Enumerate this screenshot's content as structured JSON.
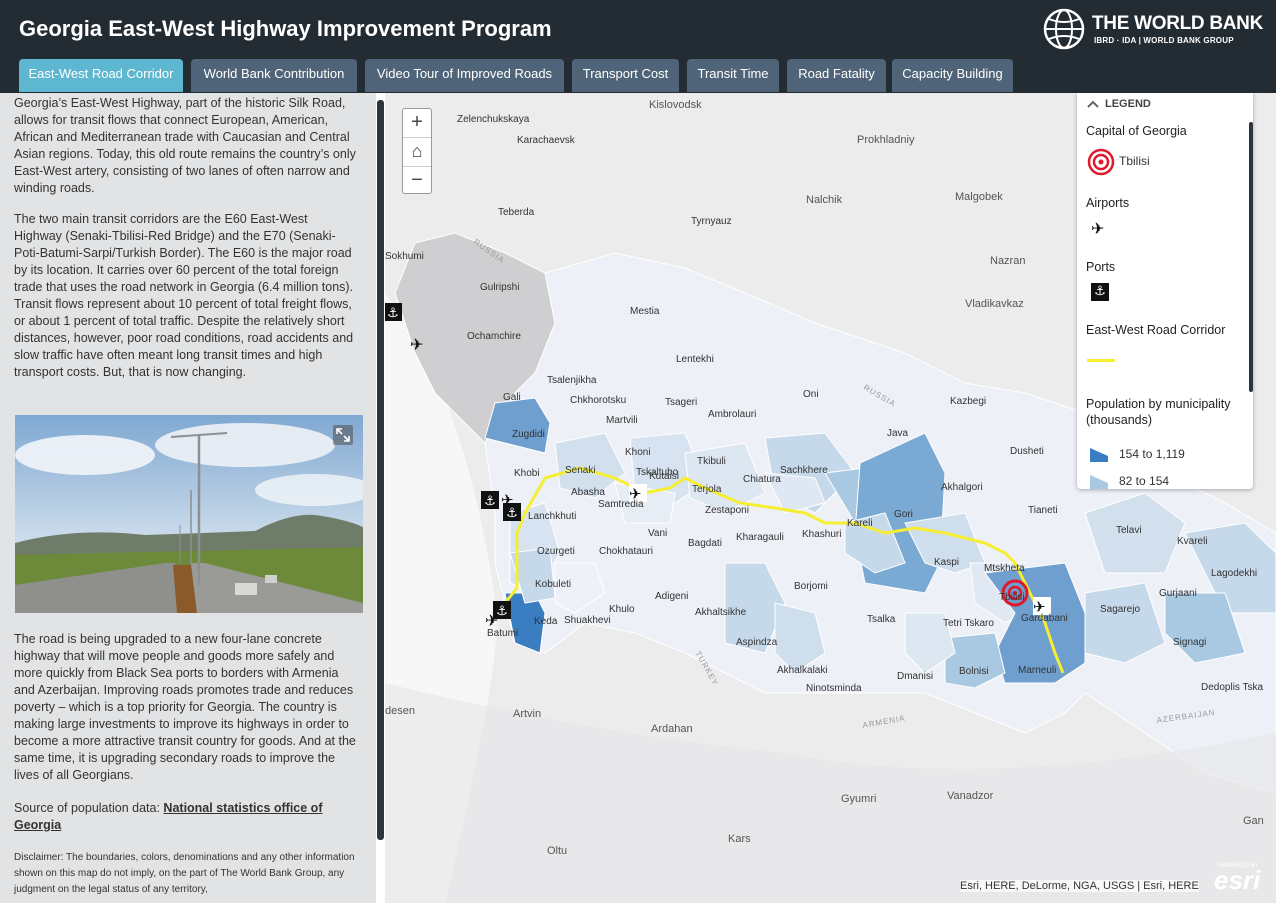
{
  "header": {
    "title": "Georgia East-West Highway Improvement Program",
    "logo_text": "THE WORLD BANK",
    "logo_sub": "IBRD · IDA | WORLD BANK GROUP"
  },
  "tabs": [
    {
      "label": "East-West Road Corridor",
      "active": true
    },
    {
      "label": "World Bank Contribution",
      "active": false
    },
    {
      "label": "Video Tour of Improved Roads",
      "active": false
    },
    {
      "label": "Transport Cost",
      "active": false
    },
    {
      "label": "Transit Time",
      "active": false
    },
    {
      "label": "Road Fatality",
      "active": false
    },
    {
      "label": "Capacity Building",
      "active": false
    }
  ],
  "panel": {
    "para1": "Georgia’s East-West Highway, part of the historic Silk Road, allows for transit flows that connect European, American, African and Mediterranean trade with Caucasian and Central Asian regions. Today, this old route remains the country’s only East-West artery, consisting of two lanes of often narrow and winding roads.",
    "para2": "The two main transit corridors are the E60 East-West Highway (Senaki-Tbilisi-Red Bridge) and the E70 (Senaki-Poti-Batumi-Sarpi/Turkish Border). The E60 is the major road by its location. It carries over 60 percent of the total foreign trade that uses the road network in Georgia (6.4 million tons). Transit flows represent about 10 percent of total freight flows, or about 1 percent of total traffic. Despite the relatively short distances, however, poor road conditions, road accidents and slow traffic have often meant long transit times and high transport costs. But, that is now changing.",
    "para3": "The road is being upgraded to a new four-lane concrete highway that will move people and goods more safely and more quickly from Black Sea ports to borders with Armenia and Azerbaijan. Improving roads promotes trade and reduces poverty – which is a top priority for Georgia. The country is making large investments to improve its highways in order to become a more attractive transit country for goods. And at the same time, it is upgrading secondary roads to improve the lives of all Georgians.",
    "source_prefix": "Source of population data: ",
    "source_link": "National statistics office of Georgia",
    "disclaimer": "Disclaimer: The boundaries, colors, denominations and any other information shown on this map do not imply, on the part of The World Bank Group, any judgment on the legal status of any territory,"
  },
  "map": {
    "zoom_in": "+",
    "home": "⌂",
    "zoom_out": "−",
    "attribution": "Esri, HERE, DeLorme, NGA, USGS | Esri, HERE",
    "esri_powered": "POWERED BY",
    "esri_logo": "esri",
    "labels_outside": [
      "Kislovodsk",
      "Zelenchukskaya",
      "Karachaevsk",
      "Prokhladniy",
      "Nalchik",
      "Malgobek",
      "Teberda",
      "Tyrnyauz",
      "Nazran",
      "Vladikavkaz",
      "Sokhumi",
      "Gulripshi",
      "Ochamchire",
      "Gali",
      "Artvin",
      "Ardahan",
      "Gyumri",
      "Vanadzor",
      "Kars",
      "Oltu",
      "desen",
      "Gan"
    ],
    "labels_regions": [
      "Mestia",
      "Lentekhi",
      "Oni",
      "Kazbegi",
      "Tsalenjikha",
      "Chkhorotsku",
      "Tsageri",
      "Ambrolauri",
      "Martvili",
      "Java",
      "Zugdidi",
      "Khoni",
      "Tkibuli",
      "Sachkhere",
      "Dusheti",
      "Khobi",
      "Senaki",
      "Tskaltubo",
      "Chiatura",
      "Akhalgori",
      "Abasha",
      "Samtredia",
      "Terjola",
      "Zestaponi",
      "Kareli",
      "Gori",
      "Tianeti",
      "Lanchkhuti",
      "Vani",
      "Kharagauli",
      "Khashuri",
      "Telavi",
      "Kvareli",
      "Ozurgeti",
      "Chokhatauri",
      "Bagdati",
      "Kaspi",
      "Mtskheta",
      "Lagodekhi",
      "Kobuleti",
      "Borjomi",
      "Gurjaani",
      "Adigeni",
      "Sagarejo",
      "Khulo",
      "Akhaltsikhe",
      "Gardabani",
      "Keda",
      "Shuakhevi",
      "Tsalka",
      "Tetri Tskaro",
      "Signagi",
      "Batumi",
      "Aspindza",
      "Akhalkalaki",
      "Dmanisi",
      "Bolnisi",
      "Marneuli",
      "Ninotsminda",
      "Dedoplis Tska",
      "Tbilisi",
      "Kutaisi"
    ],
    "labels_countries": [
      "RUSSIA",
      "RUSSIA",
      "TURKEY",
      "ARMENIA",
      "AZERBAIJAN"
    ]
  },
  "legend": {
    "title": "LEGEND",
    "capital_heading": "Capital of Georgia",
    "capital_label": "Tbilisi",
    "airports_heading": "Airports",
    "ports_heading": "Ports",
    "corridor_heading": "East-West Road Corridor",
    "population_heading": "Population by municipality (thousands)",
    "pop_classes": [
      "154 to 1,119",
      "82 to 154"
    ],
    "colors": {
      "corridor": "#f5ee32",
      "pop_high": "#3a7dc0",
      "pop_mid": "#a9c9e2",
      "capital": "#e0182d"
    }
  }
}
